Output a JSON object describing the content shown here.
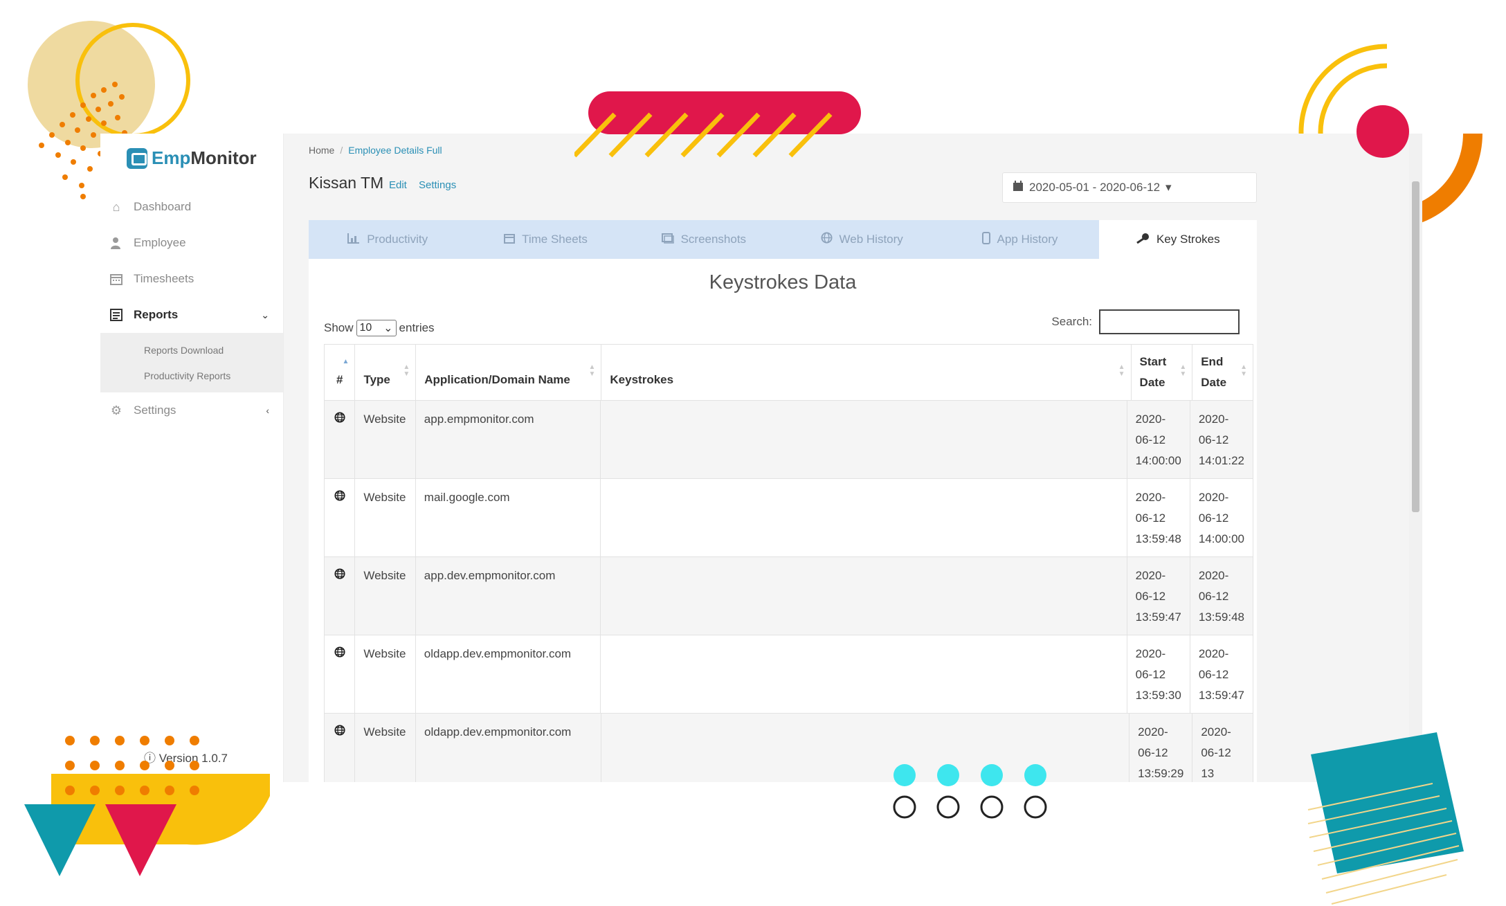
{
  "brand": {
    "name_emp": "Emp",
    "name_monitor": "Monitor"
  },
  "sidebar": {
    "items": [
      {
        "label": "Dashboard",
        "icon": "home-icon"
      },
      {
        "label": "Employee",
        "icon": "user-icon"
      },
      {
        "label": "Timesheets",
        "icon": "calendar-icon"
      },
      {
        "label": "Reports",
        "icon": "report-icon"
      },
      {
        "label": "Settings",
        "icon": "gear-icon"
      }
    ],
    "sub_items": [
      {
        "label": "Reports Download"
      },
      {
        "label": "Productivity Reports"
      }
    ],
    "version": "Version 1.0.7"
  },
  "breadcrumb": {
    "home": "Home",
    "sep": "/",
    "current": "Employee Details Full"
  },
  "employee": {
    "name": "Kissan TM",
    "edit_label": "Edit",
    "settings_label": "Settings"
  },
  "date_range": "2020-05-01 - 2020-06-12",
  "tabs": [
    {
      "label": "Productivity",
      "icon": "bar-chart-icon"
    },
    {
      "label": "Time Sheets",
      "icon": "calendar-icon"
    },
    {
      "label": "Screenshots",
      "icon": "images-icon"
    },
    {
      "label": "Web History",
      "icon": "globe-icon"
    },
    {
      "label": "App History",
      "icon": "mobile-icon"
    },
    {
      "label": "Key Strokes",
      "icon": "key-icon"
    }
  ],
  "panel": {
    "title": "Keystrokes Data",
    "show_label": "Show",
    "entries_value": "10",
    "entries_label": "entries",
    "search_label": "Search:"
  },
  "table": {
    "headers": [
      "#",
      "Type",
      "Application/Domain Name",
      "Keystrokes",
      "Start Date",
      "End Date"
    ],
    "rows": [
      {
        "type": "Website",
        "name": "app.empmonitor.com",
        "keystrokes": "",
        "start": [
          "2020-",
          "06-12",
          "14:00:00"
        ],
        "end": [
          "2020-",
          "06-12",
          "14:01:22"
        ]
      },
      {
        "type": "Website",
        "name": "mail.google.com",
        "keystrokes": "",
        "start": [
          "2020-",
          "06-12",
          "13:59:48"
        ],
        "end": [
          "2020-",
          "06-12",
          "14:00:00"
        ]
      },
      {
        "type": "Website",
        "name": "app.dev.empmonitor.com",
        "keystrokes": "",
        "start": [
          "2020-",
          "06-12",
          "13:59:47"
        ],
        "end": [
          "2020-",
          "06-12",
          "13:59:48"
        ]
      },
      {
        "type": "Website",
        "name": "oldapp.dev.empmonitor.com",
        "keystrokes": "",
        "start": [
          "2020-",
          "06-12",
          "13:59:30"
        ],
        "end": [
          "2020-",
          "06-12",
          "13:59:47"
        ]
      },
      {
        "type": "Website",
        "name": "oldapp.dev.empmonitor.com",
        "keystrokes": "",
        "start": [
          "2020-",
          "06-12",
          "13:59:29"
        ],
        "end": [
          "2020-",
          "06-12",
          "13"
        ]
      }
    ]
  },
  "colors": {
    "accent": "#2a8fb5",
    "tab_bar": "#d5e4f6",
    "red": "#e0174b",
    "yellow": "#f9c00c",
    "orange": "#ef7d00",
    "teal": "#0f9aab",
    "cyan": "#3ee6ee"
  }
}
